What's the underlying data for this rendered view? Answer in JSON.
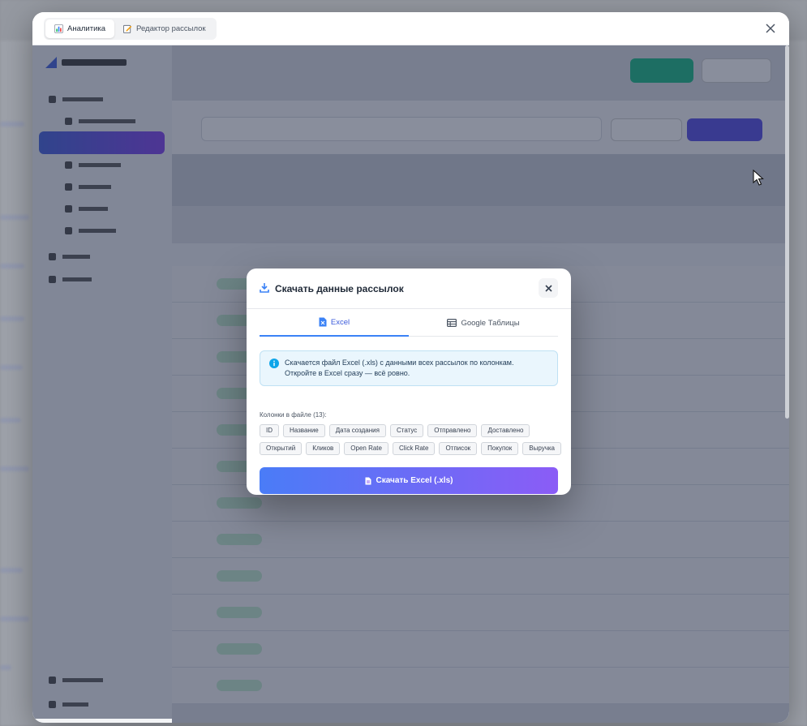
{
  "window": {
    "tabs": [
      {
        "label": "Аналитика",
        "icon": "chart-icon",
        "active": true
      },
      {
        "label": "Редактор рассылок",
        "icon": "edit-icon",
        "active": false
      }
    ]
  },
  "modal": {
    "title": "Скачать данные рассылок",
    "tabs": [
      {
        "label": "Excel",
        "icon": "excel-file-icon",
        "active": true
      },
      {
        "label": "Google Таблицы",
        "icon": "table-icon",
        "active": false
      }
    ],
    "info": {
      "line1": "Скачается файл Excel (.xls) с данными всех рассылок по колонкам.",
      "line2": "Откройте в Excel сразу — всё ровно."
    },
    "columns_label": "Колонки в файле (13):",
    "columns_row1": [
      "ID",
      "Название",
      "Дата создания",
      "Статус",
      "Отправлено",
      "Доставлено"
    ],
    "columns_row2": [
      "Открытий",
      "Кликов",
      "Open Rate",
      "Click Rate",
      "Отписок",
      "Покупок",
      "Выручка"
    ],
    "download_label": "Скачать Excel (.xls)"
  },
  "colors": {
    "accent": "#3b5bdb",
    "button_gradient_start": "#4a7cf7",
    "button_gradient_end": "#8b5cf6",
    "info_bg": "#eaf6fd"
  }
}
